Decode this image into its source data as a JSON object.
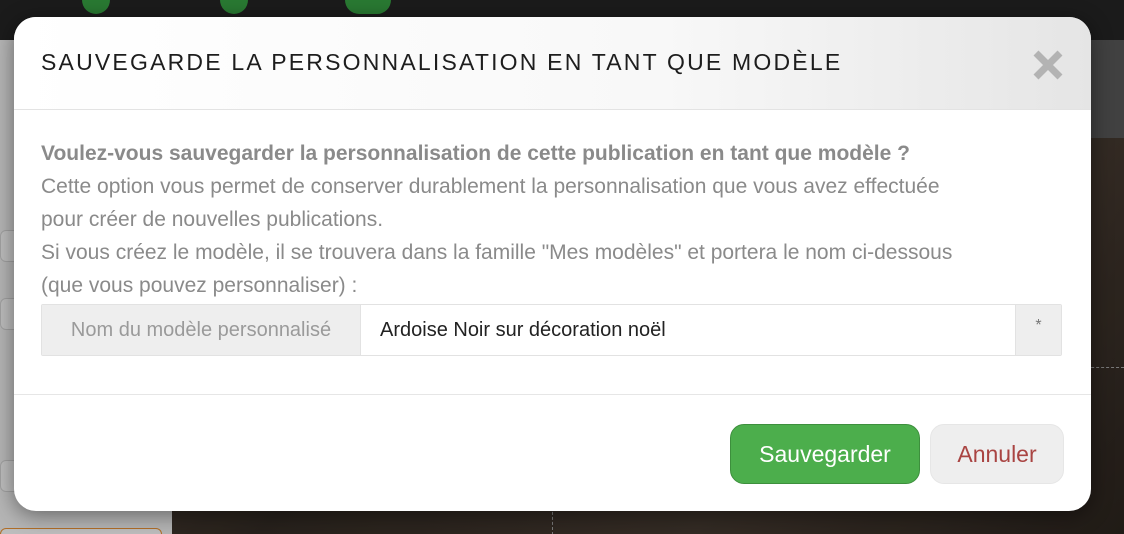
{
  "modal": {
    "title": "SAUVEGARDE LA PERSONNALISATION EN TANT QUE MODÈLE",
    "close_icon": "close-icon",
    "body": {
      "question": "Voulez-vous sauvegarder la personnalisation de cette publication en tant que modèle ?",
      "line1": "Cette option vous permet de conserver durablement la personnalisation que vous avez effectuée",
      "line2": "pour créer de nouvelles publications.",
      "line3": "Si vous créez le modèle, il se trouvera dans la famille \"Mes modèles\" et portera le nom ci-dessous",
      "line4": "(que vous pouvez personnaliser) :"
    },
    "name_field": {
      "label": "Nom du modèle personnalisé",
      "value": "Ardoise Noir sur décoration noël",
      "required_marker": "*"
    },
    "buttons": {
      "save_label": "Sauvegarder",
      "cancel_label": "Annuler"
    }
  },
  "colors": {
    "save_button": "#4cae4c",
    "cancel_text": "#a94442",
    "body_text": "#8a8a8a"
  }
}
